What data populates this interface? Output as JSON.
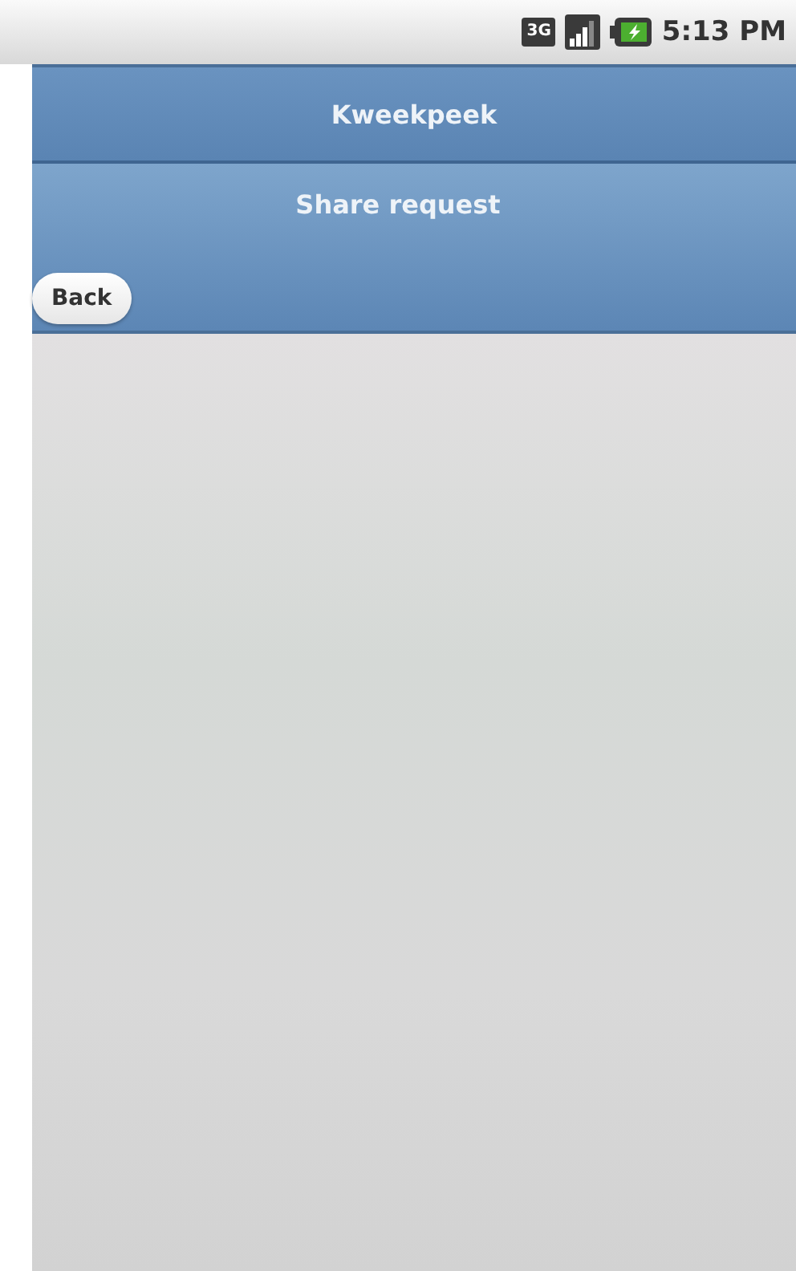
{
  "status_bar": {
    "network_type": "3G",
    "time": "5:13 PM"
  },
  "header": {
    "title": "Kweekpeek"
  },
  "subheader": {
    "title": "Share request",
    "back_button": "Back"
  }
}
